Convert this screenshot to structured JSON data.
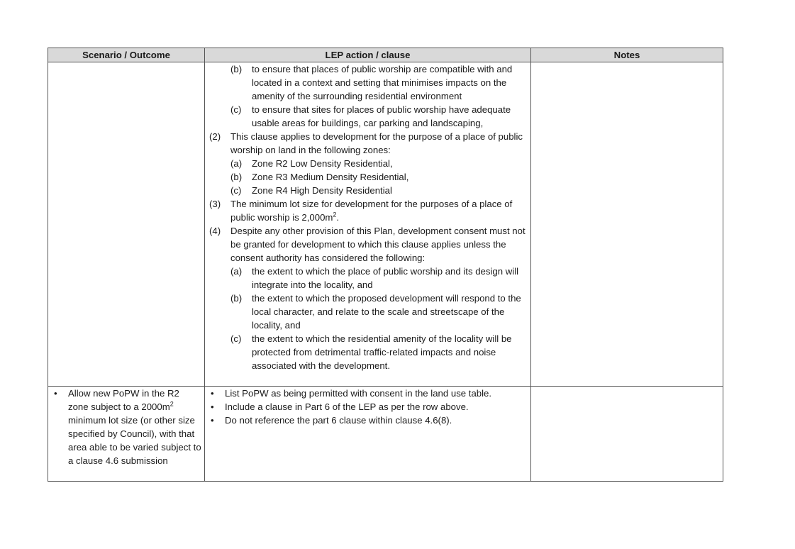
{
  "table": {
    "headers": [
      "Scenario / Outcome",
      "LEP action / clause",
      "Notes"
    ],
    "row1": {
      "scenario": "",
      "notes": "",
      "clause_items": [
        {
          "level": 2,
          "label": "(b)",
          "text": "to ensure that places of public worship are compatible with and located in a context and setting that minimises impacts on the amenity of the surrounding residential environment"
        },
        {
          "level": 2,
          "label": "(c)",
          "text": "to ensure that sites for places of public worship have adequate usable areas for buildings, car parking and landscaping,"
        },
        {
          "level": 1,
          "label": "(2)",
          "text": "This clause applies to development for the purpose of a place of public worship on land in the following zones:"
        },
        {
          "level": 2,
          "label": "(a)",
          "text": "Zone R2 Low Density Residential,"
        },
        {
          "level": 2,
          "label": "(b)",
          "text": "Zone R3 Medium Density Residential,"
        },
        {
          "level": 2,
          "label": "(c)",
          "text": "Zone R4 High Density Residential"
        },
        {
          "level": 1,
          "label": "(3)",
          "text": "The minimum lot size for development for the purposes of a place of public worship is 2,000m",
          "sup": "2",
          "after": "."
        },
        {
          "level": 1,
          "label": "(4)",
          "text": "Despite any other provision of this Plan, development consent must not be granted for development to which this clause applies unless the consent authority has considered the following:"
        },
        {
          "level": 2,
          "label": "(a)",
          "text": "the extent to which the place of public worship and its design will integrate into the locality, and"
        },
        {
          "level": 2,
          "label": "(b)",
          "text": "the extent to which the proposed development will respond to the local character, and relate to the scale and streetscape of the locality, and"
        },
        {
          "level": 2,
          "label": "(c)",
          "text": "the extent to which the residential amenity of the locality will be protected from detrimental traffic-related impacts and noise associated with the development."
        }
      ]
    },
    "row2": {
      "scenario_pre": "Allow new PoPW in the R2 zone subject to a 2000m",
      "scenario_sup": "2",
      "scenario_post": " minimum lot size (or other size specified by Council), with that area able to be varied subject to a clause 4.6 submission",
      "actions": [
        "List PoPW as being permitted with consent in the land use table.",
        "Include a clause in Part 6 of the LEP as per the row above.",
        "Do not reference the part 6 clause within clause 4.6(8)."
      ],
      "notes": ""
    }
  }
}
